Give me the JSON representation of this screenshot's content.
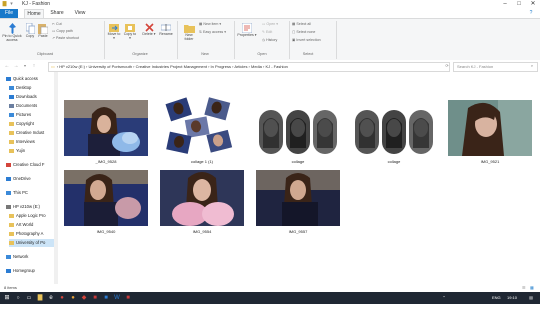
{
  "window": {
    "title": "KJ - Fashion"
  },
  "ribbon_tabs": [
    "File",
    "Home",
    "Share",
    "View"
  ],
  "ribbon": {
    "clipboard": {
      "pin": "Pin to Quick access",
      "copy": "Copy",
      "paste": "Paste",
      "cut": "Cut",
      "copy_path": "Copy path",
      "paste_shortcut": "Paste shortcut",
      "group": "Clipboard"
    },
    "organize": {
      "move_to": "Move to",
      "copy_to": "Copy to",
      "delete": "Delete",
      "rename": "Rename",
      "group": "Organize"
    },
    "new": {
      "new_folder": "New folder",
      "new_item": "New item",
      "easy_access": "Easy access",
      "group": "New"
    },
    "open": {
      "properties": "Properties",
      "open": "Open",
      "edit": "Edit",
      "history": "History",
      "group": "Open"
    },
    "select": {
      "select_all": "Select all",
      "select_none": "Select none",
      "invert": "Invert selection",
      "group": "Select"
    }
  },
  "address": {
    "path": "› HP v210w (E:) › University of Portsmouth › Creative Industries Project Management › In Progress › Articles › Media › KJ - Fashion",
    "search_placeholder": "Search KJ - Fashion"
  },
  "sidebar": {
    "items": [
      {
        "label": "Quick access",
        "color": "#2b7cd3"
      },
      {
        "label": "Desktop",
        "color": "#3b8ad9"
      },
      {
        "label": "Downloads",
        "color": "#2b7cd3"
      },
      {
        "label": "Documents",
        "color": "#6b7fa0"
      },
      {
        "label": "Pictures",
        "color": "#3b8ad9"
      },
      {
        "label": "Copyright",
        "color": "#e8c25a"
      },
      {
        "label": "Creative Indust",
        "color": "#e8c25a"
      },
      {
        "label": "Interviews",
        "color": "#e8c25a"
      },
      {
        "label": "Yujin",
        "color": "#e8c25a"
      },
      {
        "label": "Creative Cloud F",
        "color": "#d4453b"
      },
      {
        "label": "OneDrive",
        "color": "#2b7cd3"
      },
      {
        "label": "This PC",
        "color": "#3b8ad9"
      },
      {
        "label": "HP v210w (E:)",
        "color": "#777777"
      },
      {
        "label": "Apple Logic Pro",
        "color": "#e8c25a"
      },
      {
        "label": "Art World",
        "color": "#e8c25a"
      },
      {
        "label": "Photography A",
        "color": "#e8c25a"
      },
      {
        "label": "University of Po",
        "color": "#e8c25a"
      },
      {
        "label": "Network",
        "color": "#3b8ad9"
      },
      {
        "label": "Homegroup",
        "color": "#2b7cd3"
      }
    ]
  },
  "files": [
    {
      "name": "_IMG_9528",
      "kind": "photo-blue"
    },
    {
      "name": "collage 1 (1)",
      "kind": "collage-tilted"
    },
    {
      "name": "collage",
      "kind": "collage-oval"
    },
    {
      "name": "collage",
      "kind": "collage-oval"
    },
    {
      "name": "IMG_9521",
      "kind": "photo-face"
    },
    {
      "name": "IMG_9540",
      "kind": "photo-blue"
    },
    {
      "name": "IMG_9554",
      "kind": "photo-pink"
    },
    {
      "name": "IMG_9557",
      "kind": "photo-dark"
    }
  ],
  "status": {
    "count": "8 items"
  },
  "taskbar": {
    "lang": "ENG",
    "time": "19:10"
  },
  "colors": {
    "accent": "#1979ca",
    "taskbar": "#1f2733"
  }
}
